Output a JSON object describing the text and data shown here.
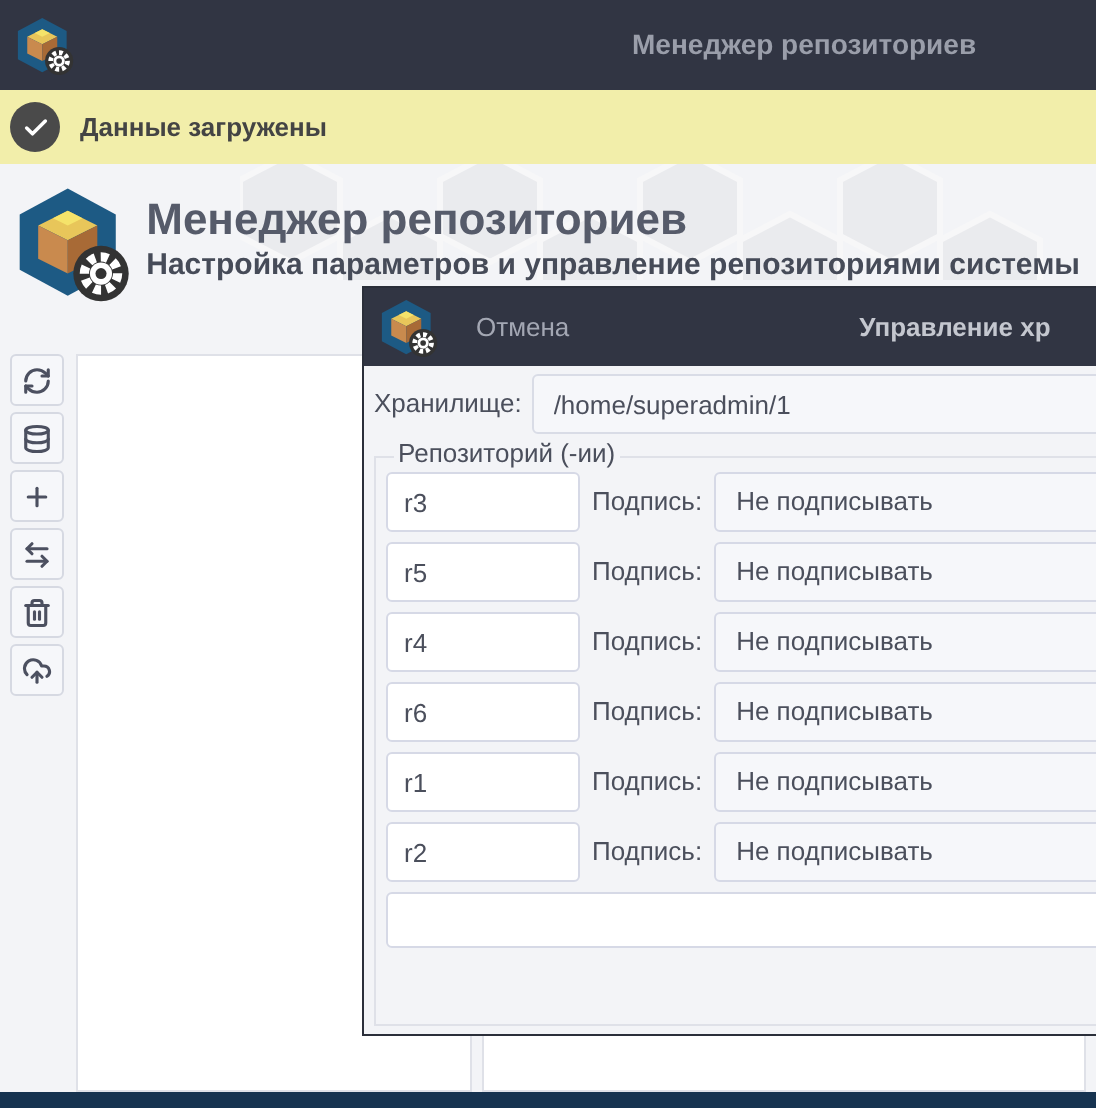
{
  "window": {
    "title": "Менеджер репозиториев"
  },
  "notification": {
    "text": "Данные загружены"
  },
  "header": {
    "title": "Менеджер репозиториев",
    "subtitle": "Настройка параметров и управление репозиториями системы"
  },
  "toolbar": [
    {
      "kind": "refresh"
    },
    {
      "kind": "database"
    },
    {
      "kind": "add"
    },
    {
      "kind": "swap"
    },
    {
      "kind": "delete"
    },
    {
      "kind": "upload"
    }
  ],
  "dialog": {
    "cancel": "Отмена",
    "title": "Управление хр",
    "storage_label": "Хранилище:",
    "storage_value": "/home/superadmin/1",
    "group_title": "Репозиторий (-ии)",
    "repositories": [
      {
        "name": "r3",
        "signature_label": "Подпись:",
        "signature": "Не подписывать"
      },
      {
        "name": "r5",
        "signature_label": "Подпись:",
        "signature": "Не подписывать"
      },
      {
        "name": "r4",
        "signature_label": "Подпись:",
        "signature": "Не подписывать"
      },
      {
        "name": "r6",
        "signature_label": "Подпись:",
        "signature": "Не подписывать"
      },
      {
        "name": "r1",
        "signature_label": "Подпись:",
        "signature": "Не подписывать"
      },
      {
        "name": "r2",
        "signature_label": "Подпись:",
        "signature": "Не подписывать"
      }
    ]
  }
}
